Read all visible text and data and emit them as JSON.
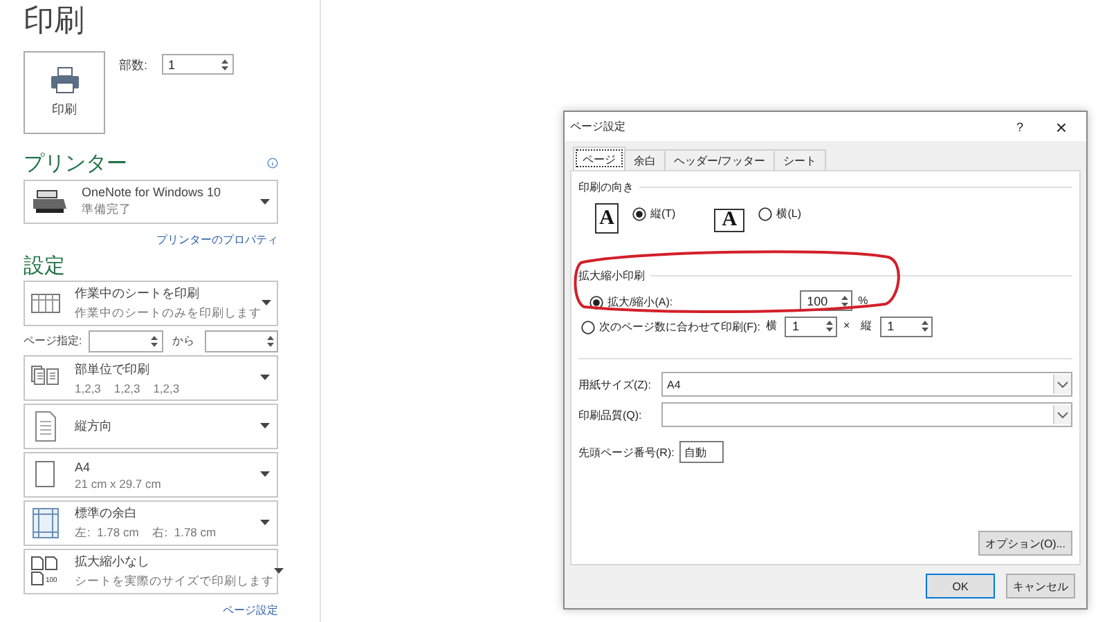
{
  "title": "印刷",
  "print_button": {
    "label": "印刷"
  },
  "copies": {
    "label": "部数:",
    "value": "1"
  },
  "printer": {
    "heading": "プリンター",
    "name": "OneNote for Windows 10",
    "status": "準備完了",
    "properties_link": "プリンターのプロパティ"
  },
  "settings": {
    "heading": "設定",
    "items": [
      {
        "kind": "sheets",
        "title": "作業中のシートを印刷",
        "subtitle": "作業中のシートのみを印刷します"
      },
      {
        "kind": "page_range",
        "label": "ページ指定:",
        "to_label": "から"
      },
      {
        "kind": "collate",
        "title": "部単位で印刷",
        "subtitle": "1,2,3    1,2,3    1,2,3"
      },
      {
        "kind": "orientation",
        "title": "縦方向"
      },
      {
        "kind": "paper",
        "title": "A4",
        "subtitle": "21 cm x 29.7 cm"
      },
      {
        "kind": "margins",
        "title": "標準の余白",
        "subtitle": "左:  1.78 cm    右:  1.78 cm"
      },
      {
        "kind": "scaling",
        "title": "拡大縮小なし",
        "subtitle": "シートを実際のサイズで印刷します",
        "badge": "100"
      }
    ],
    "page_setup_link": "ページ設定"
  },
  "dialog": {
    "title": "ページ設定",
    "help": "?",
    "close": "×",
    "tabs": [
      {
        "label": "ページ",
        "selected": true
      },
      {
        "label": "余白",
        "selected": false
      },
      {
        "label": "ヘッダー/フッター",
        "selected": false
      },
      {
        "label": "シート",
        "selected": false
      }
    ],
    "orientation": {
      "heading": "印刷の向き",
      "options": [
        {
          "kind": "portrait",
          "glyph": "A",
          "label": "縦(T)",
          "selected": true
        },
        {
          "kind": "landscape",
          "glyph": "A",
          "label": "横(L)",
          "selected": false
        }
      ]
    },
    "scaling": {
      "heading": "拡大縮小印刷",
      "options": [
        {
          "kind": "percent",
          "label": "拡大/縮小(A):",
          "selected": true,
          "value": "100",
          "unit": "%"
        },
        {
          "kind": "fit",
          "label": "次のページ数に合わせて印刷(F):",
          "selected": false,
          "wide_label": "横",
          "wide_value": "1",
          "times": "×",
          "tall_label": "縦",
          "tall_value": "1"
        }
      ]
    },
    "paper_size": {
      "label": "用紙サイズ(Z):",
      "value": "A4"
    },
    "print_quality": {
      "label": "印刷品質(Q):"
    },
    "first_page_number": {
      "label": "先頭ページ番号(R):",
      "value": "自動"
    },
    "options_button": "オプション(O)...",
    "buttons": [
      {
        "label": "OK",
        "kind": "default"
      },
      {
        "label": "キャンセル",
        "kind": "normal"
      }
    ]
  }
}
